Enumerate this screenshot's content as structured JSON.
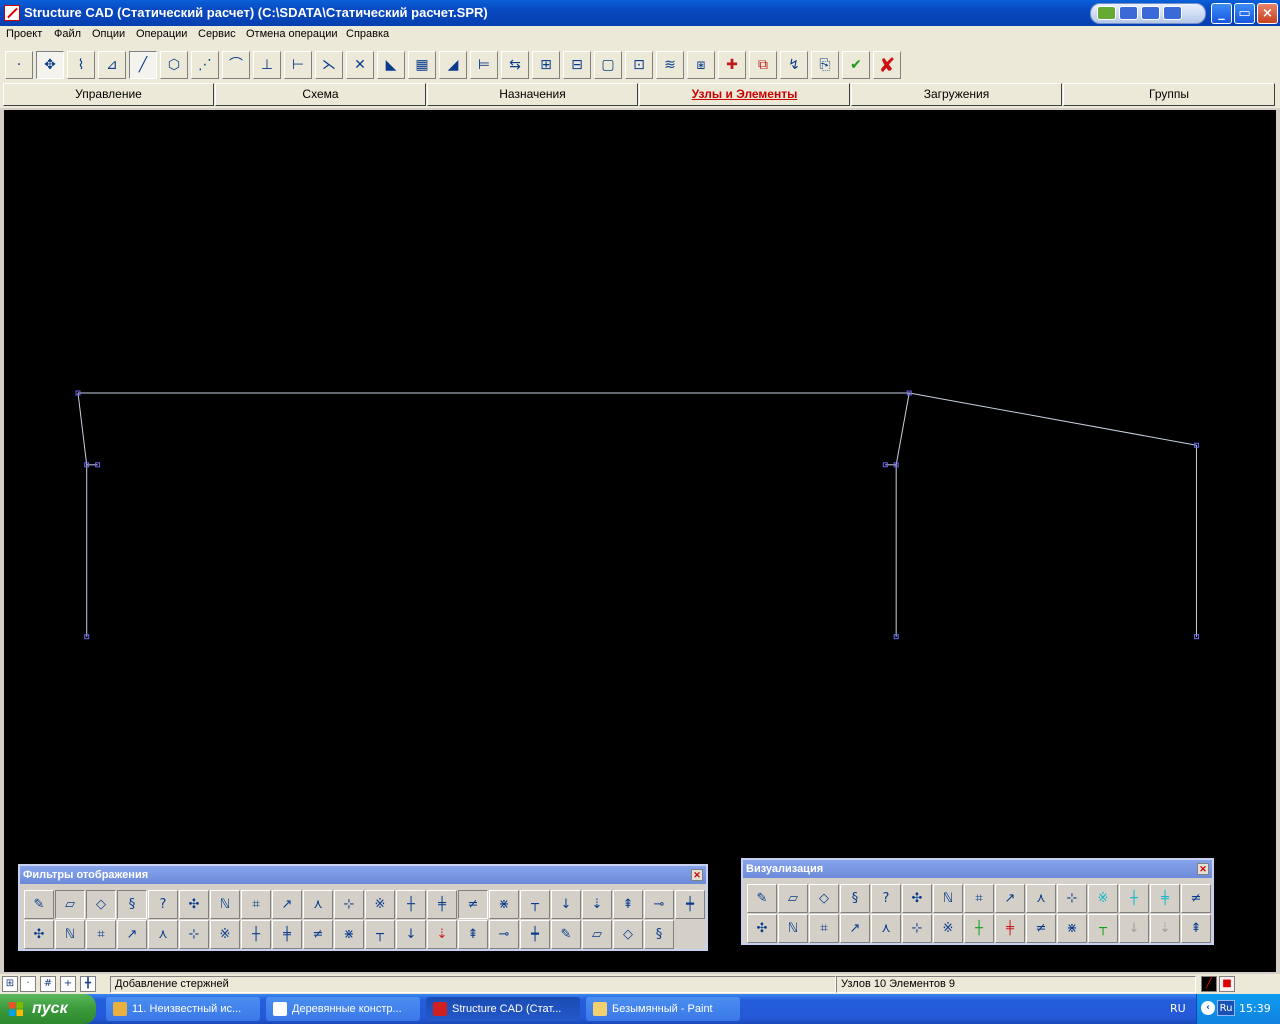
{
  "window": {
    "title": "Structure CAD (Статический расчет) (C:\\SDATA\\Статический расчет.SPR)",
    "minimize": "_",
    "maximize": "▭",
    "close": "×"
  },
  "menu": [
    "Проект",
    "Файл",
    "Опции",
    "Операции",
    "Сервис",
    "Отмена операции",
    "Справка"
  ],
  "tabs": [
    {
      "label": "Управление",
      "active": false
    },
    {
      "label": "Схема",
      "active": false
    },
    {
      "label": "Назначения",
      "active": false
    },
    {
      "label": "Узлы и Элементы",
      "active": true
    },
    {
      "label": "Загружения",
      "active": false
    },
    {
      "label": "Группы",
      "active": false
    }
  ],
  "toolbar_icons": [
    "add-node-icon",
    "node-grid-icon",
    "node-spring-icon",
    "node-plane-icon",
    "add-bar-icon",
    "bar-3d-icon",
    "bar-points-icon",
    "bar-chain-icon",
    "split-bar-icon",
    "divide-bar-icon",
    "bar-align-icon",
    "cross-bars-icon",
    "plate-icon",
    "plate-mesh-icon",
    "triangle-plate-icon",
    "measure-icon",
    "move-icon",
    "copy-group-icon",
    "copy-array-icon",
    "frame-select-icon",
    "rect-select-icon",
    "layer-icon",
    "packing-icon",
    "delete-node-icon",
    "delete-element-icon",
    "rotate-icon",
    "clipboard-icon",
    "confirm-icon",
    "cancel-icon"
  ],
  "filters_palette": {
    "title": "Фильтры отображения",
    "row1": [
      "pencil-icon",
      "eraser-icon",
      "cube-icon",
      "spring-icon",
      "node-number-icon",
      "node-info-icon",
      "node-ne-icon",
      "node-nj-icon",
      "node-te-icon",
      "node-r-icon",
      "supports-icon",
      "coords-icon",
      "axis-icon",
      "local-axis-icon",
      "hinge-icon",
      "rigid-icon",
      "beam-icon",
      "load-icon",
      "force-icon",
      "moment-icon",
      "mass-icon",
      "dimension-icon"
    ],
    "row2": [
      "pointer-icon",
      "grid-icon",
      "table-icon",
      "mesh-icon",
      "brush-icon",
      "paint-icon",
      "layers-icon",
      "node-dots-icon",
      "element-n-icon",
      "element-g-icon",
      "element-g2-icon",
      "cross-icon",
      "frame-icon",
      "grid-red-icon",
      "material-icon",
      "chart-icon",
      "section-icon",
      "stack-icon",
      "triangle-icon",
      "table-sum-icon",
      "list-sum-icon"
    ]
  },
  "visualization_palette": {
    "title": "Визуализация",
    "row1": [
      "view-front-icon",
      "rotate-x-icon",
      "rotate-x2-icon",
      "rotate-z-icon",
      "rotate-z2-icon",
      "rotate-y-icon",
      "rotate-y2-icon",
      "projection-xy-icon",
      "projection-xz-icon",
      "projection-yz-icon",
      "iso-icon",
      "cube-cyan-icon",
      "cube-cyan2-icon",
      "cube-cyan3-icon",
      "cube-blue-icon"
    ],
    "row2": [
      "scissors-icon",
      "fragment-icon",
      "columns-icon",
      "menu-icon",
      "zoom-icon",
      "zoom-reset-icon",
      "print-icon",
      "green-ball-icon",
      "red-ball-icon",
      "picture-icon",
      "grid-dots-icon",
      "grid-green-icon",
      "disabled-icon",
      "disabled2-icon",
      "numbering-icon"
    ]
  },
  "status": {
    "message": "Добавление стержней",
    "counts": "Узлов 10 Элементов 9"
  },
  "taskbar": {
    "start_label": "пуск",
    "tasks": [
      {
        "label": "11. Неизвестный ис...",
        "icon_color": "#e8b040",
        "active": false
      },
      {
        "label": "Деревянные констр...",
        "icon_color": "#ffffff",
        "active": false
      },
      {
        "label": "Structure CAD (Стат...",
        "icon_color": "#d02020",
        "active": true
      },
      {
        "label": "Безымянный - Paint",
        "icon_color": "#f0d070",
        "active": false
      }
    ],
    "lang": "RU",
    "lang_indicator": "Ru",
    "clock": "15:39"
  },
  "scheme": {
    "nodes": [
      {
        "x": 0,
        "y": 0
      },
      {
        "x": 0.4,
        "y": 3.3
      },
      {
        "x": 0.9,
        "y": 3.3
      },
      {
        "x": 0.4,
        "y": 11.2
      },
      {
        "x": 38.2,
        "y": 0
      },
      {
        "x": 37.6,
        "y": 3.3
      },
      {
        "x": 37.1,
        "y": 3.3
      },
      {
        "x": 37.6,
        "y": 11.2
      },
      {
        "x": 51.4,
        "y": 2.4
      },
      {
        "x": 51.4,
        "y": 11.2
      }
    ],
    "bars": [
      [
        0,
        4
      ],
      [
        4,
        8
      ],
      [
        0,
        1
      ],
      [
        1,
        3
      ],
      [
        1,
        2
      ],
      [
        4,
        5
      ],
      [
        5,
        7
      ],
      [
        5,
        6
      ],
      [
        8,
        9
      ]
    ],
    "colors": {
      "bar": "#c8d0e0",
      "node": "#6a6af0",
      "background": "#000000"
    }
  }
}
